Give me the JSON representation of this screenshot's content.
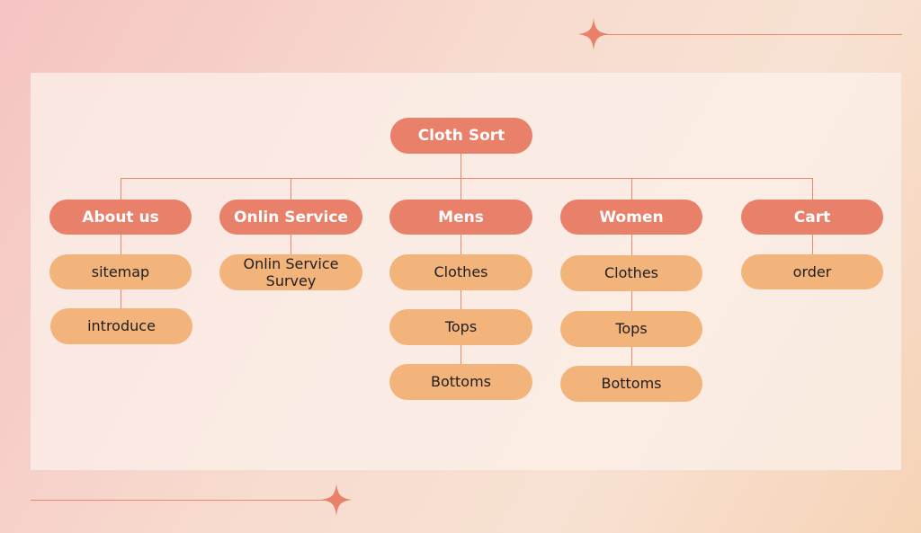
{
  "diagram": {
    "root": "Cloth Sort",
    "categories": [
      {
        "label": "About us",
        "items": [
          "sitemap",
          "introduce"
        ]
      },
      {
        "label": "Onlin Service",
        "items": [
          "Onlin Service Survey"
        ]
      },
      {
        "label": "Mens",
        "items": [
          "Clothes",
          "Tops",
          "Bottoms"
        ]
      },
      {
        "label": "Women",
        "items": [
          "Clothes",
          "Tops",
          "Bottoms"
        ]
      },
      {
        "label": "Cart",
        "items": [
          "order"
        ]
      }
    ]
  },
  "colors": {
    "primary_node": "#e8806a",
    "secondary_node": "#f3b47c",
    "connector": "#e8886a"
  },
  "icons": [
    "four-point-star-icon",
    "four-point-star-icon"
  ]
}
